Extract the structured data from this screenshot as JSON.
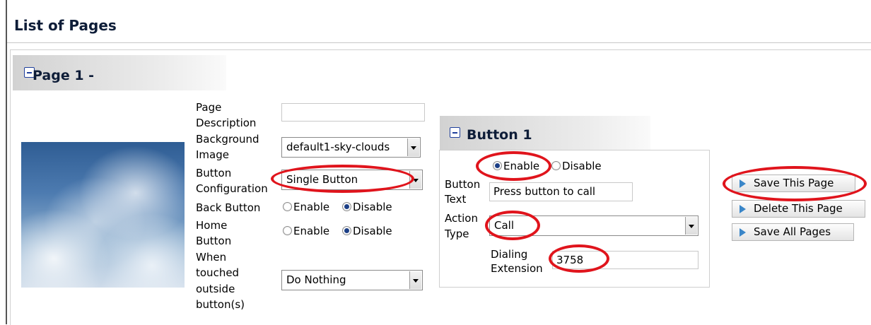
{
  "header": {
    "title": "List of Pages"
  },
  "page": {
    "title": "Page 1 -",
    "background_preview": "sky-clouds-image",
    "fields": {
      "description_label_1": "Page",
      "description_label_2": "Description",
      "description_value": "",
      "bg_label_1": "Background",
      "bg_label_2": "Image",
      "bg_value": "default1-sky-clouds",
      "config_label_1": "Button",
      "config_label_2": "Configuration",
      "config_value": "Single Button",
      "back_label": "Back Button",
      "back_enable": "Enable",
      "back_disable": "Disable",
      "home_label_1": "Home",
      "home_label_2": "Button",
      "home_enable": "Enable",
      "home_disable": "Disable",
      "touch_label_1": "When",
      "touch_label_2": "touched",
      "touch_label_3": "outside",
      "touch_label_4": "button(s)",
      "touch_value": "Do Nothing"
    }
  },
  "button1": {
    "title": "Button 1",
    "enable_label": "Enable",
    "disable_label": "Disable",
    "text_label_1": "Button",
    "text_label_2": "Text",
    "text_value": "Press button to call",
    "action_label_1": "Action",
    "action_label_2": "Type",
    "action_value": "Call",
    "dial_label_1": "Dialing",
    "dial_label_2": "Extension",
    "dial_value": "3758"
  },
  "actions": {
    "save_page": "Save This Page",
    "delete_page": "Delete This Page",
    "save_all": "Save All Pages"
  },
  "colors": {
    "accent": "#0e1d38",
    "highlight": "#e0141c",
    "icon": "#3a86c8"
  }
}
